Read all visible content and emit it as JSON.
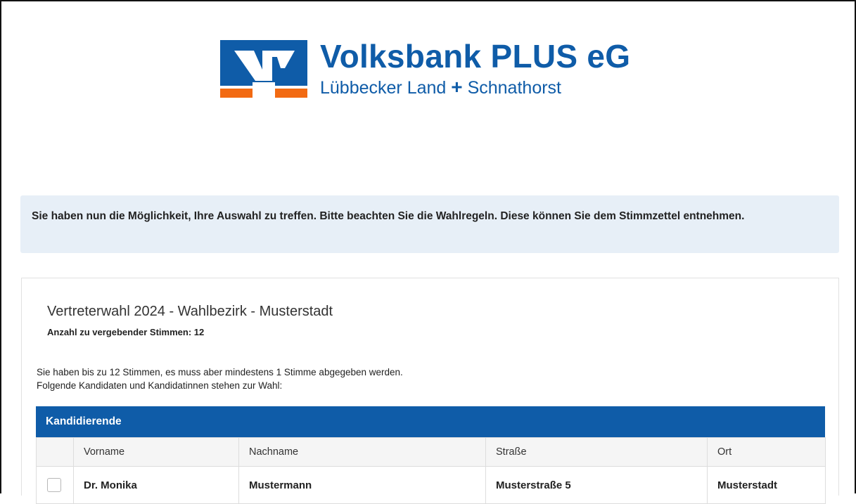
{
  "brand": {
    "name": "Volksbank PLUS eG",
    "subtitle_left": "Lübbecker Land",
    "subtitle_plus": "+",
    "subtitle_right": "Schnathorst",
    "colors": {
      "blue": "#0f5ca8",
      "orange": "#f26a12"
    }
  },
  "notice": {
    "text": "Sie haben nun die Möglichkeit, Ihre Auswahl zu treffen. Bitte beachten Sie die Wahlregeln. Diese können Sie dem Stimmzettel entnehmen."
  },
  "election": {
    "title": "Vertreterwahl 2024 - Wahlbezirk - Musterstadt",
    "votes_label": "Anzahl zu vergebender Stimmen: 12",
    "rule_line1": "Sie haben bis zu 12 Stimmen, es muss aber mindestens 1 Stimme abgegeben werden.",
    "rule_line2": "Folgende Kandidaten und Kandidatinnen stehen zur Wahl:"
  },
  "candidates": {
    "header": "Kandidierende",
    "columns": [
      "",
      "Vorname",
      "Nachname",
      "Straße",
      "Ort"
    ],
    "rows": [
      {
        "checked": false,
        "vorname": "Dr. Monika",
        "nachname": "Mustermann",
        "strasse": "Musterstraße 5",
        "ort": "Musterstadt"
      }
    ]
  }
}
